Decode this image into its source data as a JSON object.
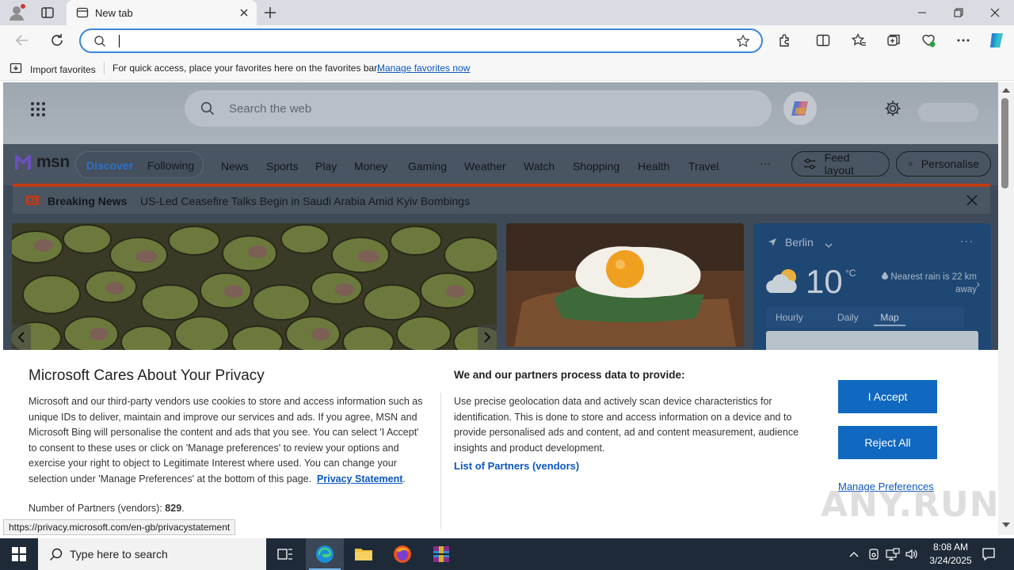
{
  "browser": {
    "tab_title": "New tab",
    "address_value": "",
    "favorites_bar": {
      "import_label": "Import favorites",
      "message": "For quick access, place your favorites here on the favorites bar.",
      "manage_link": "Manage favorites now"
    }
  },
  "msn_page": {
    "search_placeholder": "Search the web",
    "logo_text": "msn",
    "segment": {
      "discover": "Discover",
      "following": "Following"
    },
    "nav_items": [
      "News",
      "Sports",
      "Play",
      "Money",
      "Gaming",
      "Weather",
      "Watch",
      "Shopping",
      "Health",
      "Travel"
    ],
    "more_label": "···",
    "feed_layout_label": "Feed layout",
    "personalise_label": "Personalise",
    "breaking": {
      "label": "Breaking News",
      "headline": "US-Led Ceasefire Talks Begin in Saudi Arabia Amid Kyiv Bombings"
    },
    "weather": {
      "location": "Berlin",
      "temperature": "10",
      "unit": "°C",
      "rain_note": "Nearest rain is 22 km away",
      "tabs": [
        "Hourly",
        "Daily",
        "Map"
      ],
      "active_tab": "Map"
    }
  },
  "privacy": {
    "title": "Microsoft Cares About Your Privacy",
    "body_text": "Microsoft and our third-party vendors use cookies to store and access information such as unique IDs to deliver, maintain and improve our services and ads. If you agree, MSN and Microsoft Bing will personalise the content and ads that you see. You can select 'I Accept' to consent to these uses or click on 'Manage preferences' to review your options and exercise your right to object to Legitimate Interest where used.  You can change your selection under 'Manage Preferences' at the bottom of this page.",
    "privacy_link": "Privacy Statement",
    "partners_label": "Number of Partners (vendors):",
    "partners_count": "829",
    "right_title": "We and our partners process data to provide:",
    "right_body": "Use precise geolocation data and actively scan device characteristics for identification. This is done to store and access information on a device and to provide personalised ads and content, ad and content measurement, audience insights and product development.",
    "vendors_link": "List of Partners (vendors)",
    "accept_label": "I Accept",
    "reject_label": "Reject All",
    "manage_label": "Manage Preferences"
  },
  "status_url": "https://privacy.microsoft.com/en-gb/privacystatement",
  "watermark": "ANY.RUN",
  "taskbar": {
    "search_placeholder": "Type here to search",
    "time": "8:08 AM",
    "date": "3/24/2025"
  },
  "colors": {
    "accent_blue": "#1068c0",
    "link_blue": "#0b57c2",
    "breaking_red": "#c03a14",
    "address_border": "#3b86d8"
  }
}
